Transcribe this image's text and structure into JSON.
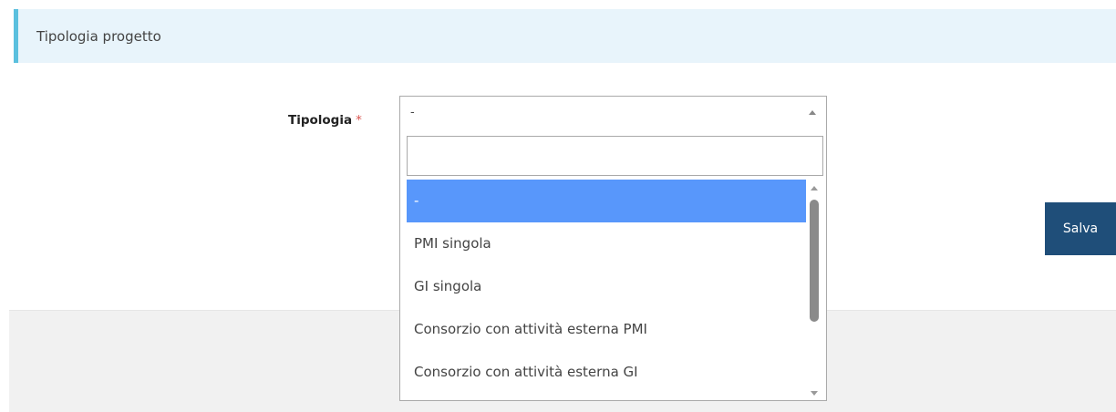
{
  "section": {
    "title": "Tipologia progetto"
  },
  "form": {
    "tipologia_label": "Tipologia",
    "required_marker": "*",
    "select": {
      "selected_value": "-",
      "arrow_icon": "caret-up-icon",
      "search_value": ""
    },
    "options": [
      "-",
      "PMI singola",
      "GI singola",
      "Consorzio con attività esterna PMI",
      "Consorzio con attività esterna GI"
    ],
    "highlighted_option": "-"
  },
  "actions": {
    "save_label": "Salva"
  },
  "colors": {
    "header_bg": "#e8f4fb",
    "header_accent": "#5bc0de",
    "highlight": "#5897fb",
    "save_button": "#1f4e79",
    "required": "#d9534f"
  }
}
